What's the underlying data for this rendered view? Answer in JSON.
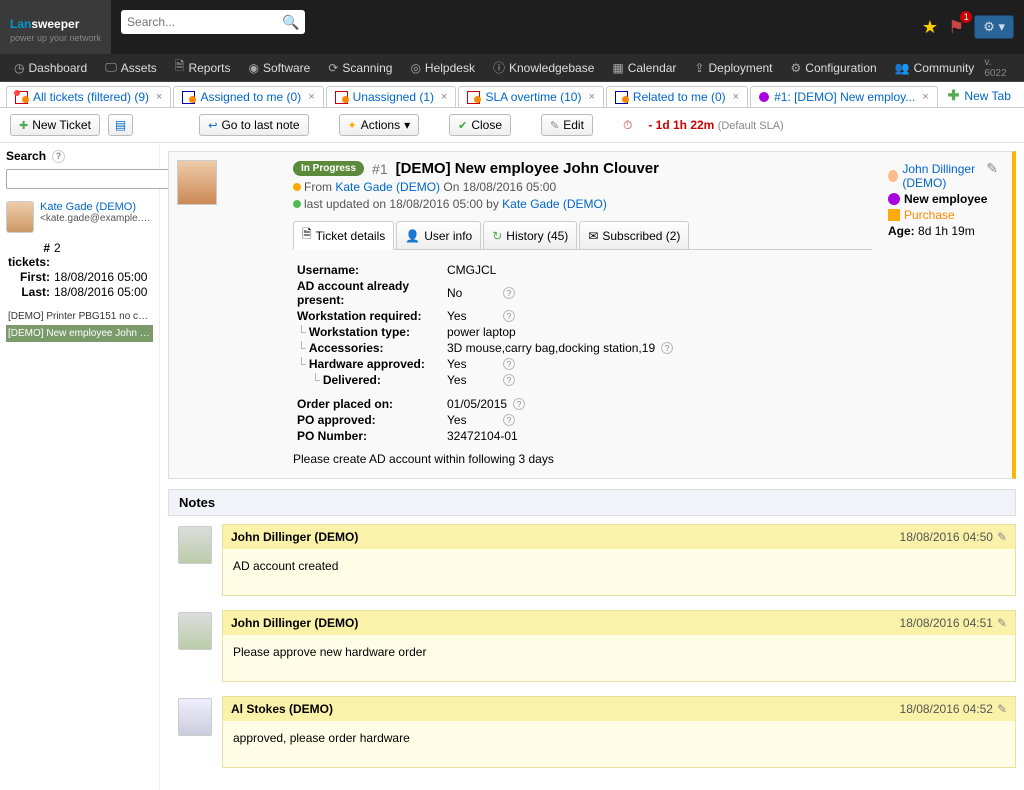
{
  "logo": {
    "part1": "Lan",
    "part2": "sweeper",
    "sub": "power up your network"
  },
  "search": {
    "placeholder": "Search..."
  },
  "notif": {
    "count": "1"
  },
  "nav": {
    "items": [
      "Dashboard",
      "Assets",
      "Reports",
      "Software",
      "Scanning",
      "Helpdesk",
      "Knowledgebase",
      "Calendar",
      "Deployment",
      "Configuration",
      "Community"
    ],
    "version": "v. 6022"
  },
  "tabs": [
    {
      "label": "All tickets (filtered) (9)"
    },
    {
      "label": "Assigned to me (0)"
    },
    {
      "label": "Unassigned (1)"
    },
    {
      "label": "SLA overtime (10)"
    },
    {
      "label": "Related to me (0)"
    },
    {
      "label": "#1: [DEMO] New employ..."
    }
  ],
  "newtab": "New Tab",
  "toolbar": {
    "new_ticket": "New Ticket",
    "goto": "Go to last note",
    "actions": "Actions",
    "close": "Close",
    "edit": "Edit",
    "sla": "- 1d 1h 22m",
    "sla_default": "(Default SLA)"
  },
  "sidebar": {
    "heading": "Search",
    "user": {
      "name": "Kate Gade (DEMO)",
      "email": "<kate.gade@example.or..."
    },
    "stats": {
      "tickets_k": "# tickets:",
      "tickets_v": "2",
      "first_k": "First:",
      "first_v": "18/08/2016 05:00",
      "last_k": "Last:",
      "last_v": "18/08/2016 05:00"
    },
    "list": [
      "[DEMO] Printer PBG151 no conn..",
      "[DEMO] New employee John Cl.."
    ]
  },
  "ticket": {
    "status": "In Progress",
    "num": "#1",
    "title": "[DEMO] New employee John Clouver",
    "from_pfx": "From ",
    "from_user": "Kate Gade (DEMO)",
    "from_on": " On 18/08/2016 05:00",
    "upd_pfx": "last updated on 18/08/2016 05:00 by ",
    "upd_user": "Kate Gade (DEMO)",
    "dtabs": {
      "details": "Ticket details",
      "user": "User info",
      "history": "History (45)",
      "sub": "Subscribed (2)"
    },
    "fields": {
      "username_k": "Username:",
      "username_v": "CMGJCL",
      "ad_k": "AD account already present:",
      "ad_v": "No",
      "ws_k": "Workstation required:",
      "ws_v": "Yes",
      "wstype_k": "Workstation type:",
      "wstype_v": "power laptop",
      "acc_k": "Accessories:",
      "acc_v": "3D mouse,carry bag,docking station,19",
      "hw_k": "Hardware approved:",
      "hw_v": "Yes",
      "del_k": "Delivered:",
      "del_v": "Yes",
      "order_k": "Order placed on:",
      "order_v": "01/05/2015",
      "po_k": "PO approved:",
      "po_v": "Yes",
      "pon_k": "PO Number:",
      "pon_v": "32472104-01"
    },
    "desc": "Please create AD account within following 3 days",
    "side": {
      "assignee": "John Dillinger (DEMO)",
      "type": "New employee",
      "purchase": "Purchase",
      "age_k": "Age:",
      "age_v": "8d 1h 19m"
    }
  },
  "notes": {
    "heading": "Notes",
    "items": [
      {
        "author": "John Dillinger (DEMO)",
        "when": "18/08/2016 04:50",
        "body": "AD account created"
      },
      {
        "author": "John Dillinger (DEMO)",
        "when": "18/08/2016 04:51",
        "body": "Please approve new hardware order"
      },
      {
        "author": "Al Stokes (DEMO)",
        "when": "18/08/2016 04:52",
        "body": "approved, please order hardware"
      }
    ]
  }
}
